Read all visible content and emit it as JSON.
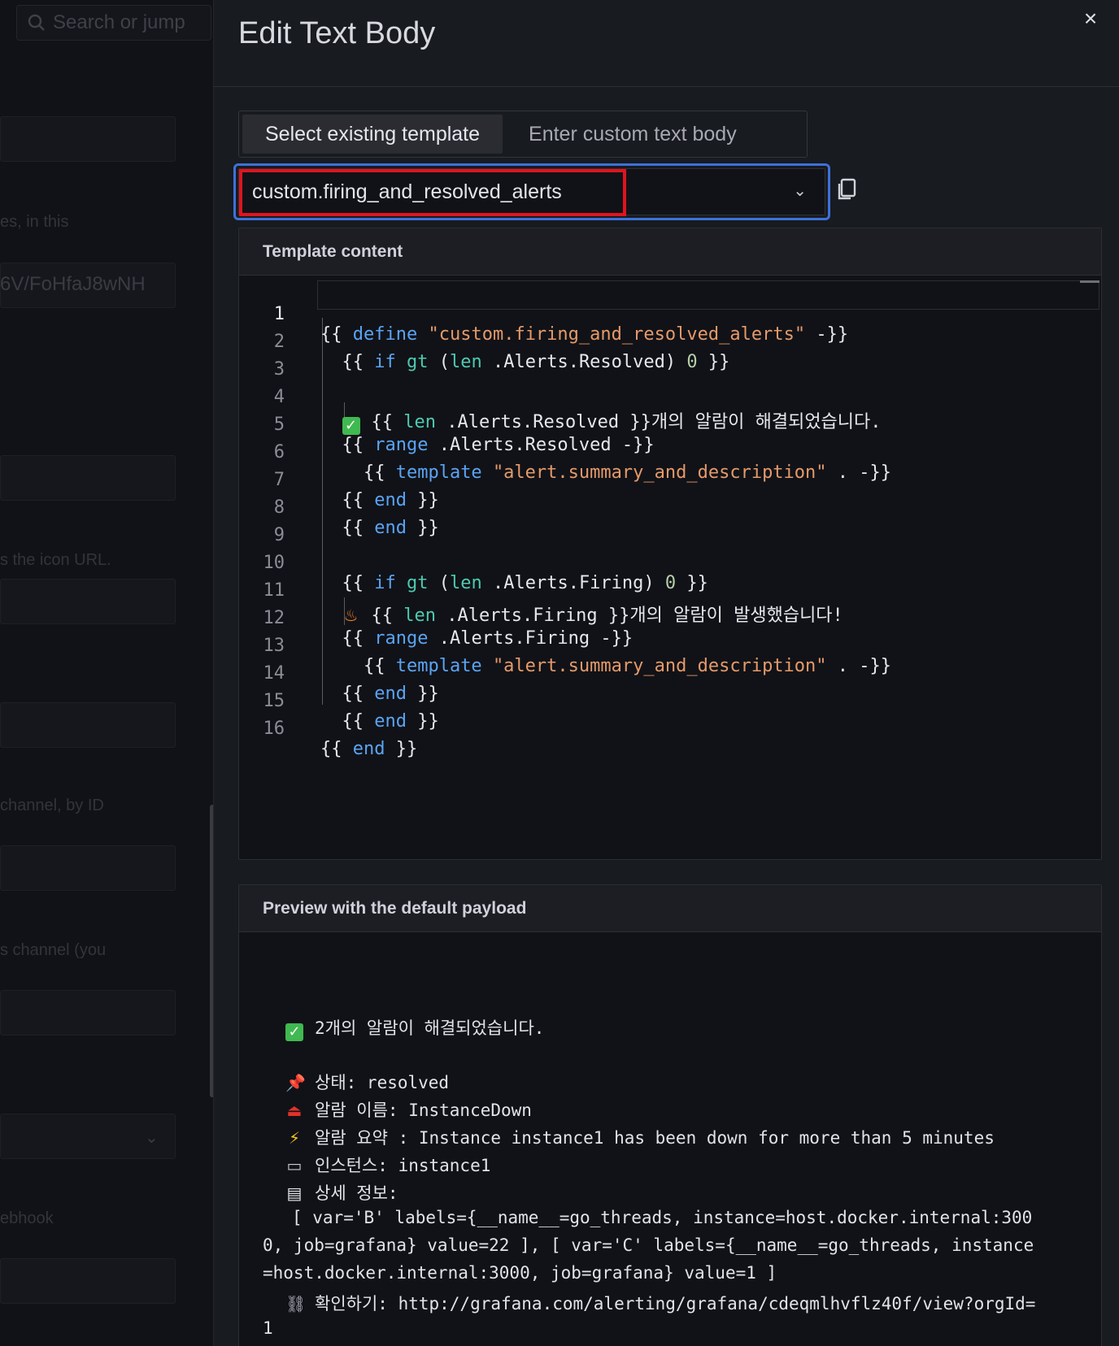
{
  "background": {
    "search_placeholder": "Search or jump",
    "texts": [
      "es, in this",
      "6V/FoHfaJ8wNH",
      "s the icon URL.",
      "channel, by ID",
      "s channel (you",
      "ebhook"
    ]
  },
  "drawer": {
    "title": "Edit Text Body",
    "close_label": "×",
    "tabs": [
      {
        "label": "Select existing template",
        "active": true
      },
      {
        "label": "Enter custom text body",
        "active": false
      }
    ],
    "template_select": {
      "value": "custom.firing_and_resolved_alerts"
    },
    "copy_icon": "copy-icon"
  },
  "template_panel": {
    "header": "Template content",
    "line_numbers": [
      "1",
      "2",
      "3",
      "4",
      "5",
      "6",
      "7",
      "8",
      "9",
      "10",
      "11",
      "12",
      "13",
      "14",
      "15",
      "16"
    ]
  },
  "preview_panel": {
    "header": "Preview with the default payload",
    "resolved_summary": "2개의 알람이 해결되었습니다.",
    "status": "상태: resolved",
    "alert_name": "알람 이름: InstanceDown",
    "alert_summary": "알람 요약 : Instance instance1 has been down for more than 5 minutes",
    "instance": "인스턴스: instance1",
    "details_label": "상세 정보:",
    "details_line1": "[ var='B' labels={__name__=go_threads, instance=host.docker.internal:300",
    "details_line2": "0, job=grafana} value=22 ], [ var='C' labels={__name__=go_threads, instance",
    "details_line3": "=host.docker.internal:3000, job=grafana} value=1 ]",
    "link_line1": "확인하기: http://grafana.com/alerting/grafana/cdeqmlhvflz40f/view?orgId=",
    "link_line2": "1"
  }
}
